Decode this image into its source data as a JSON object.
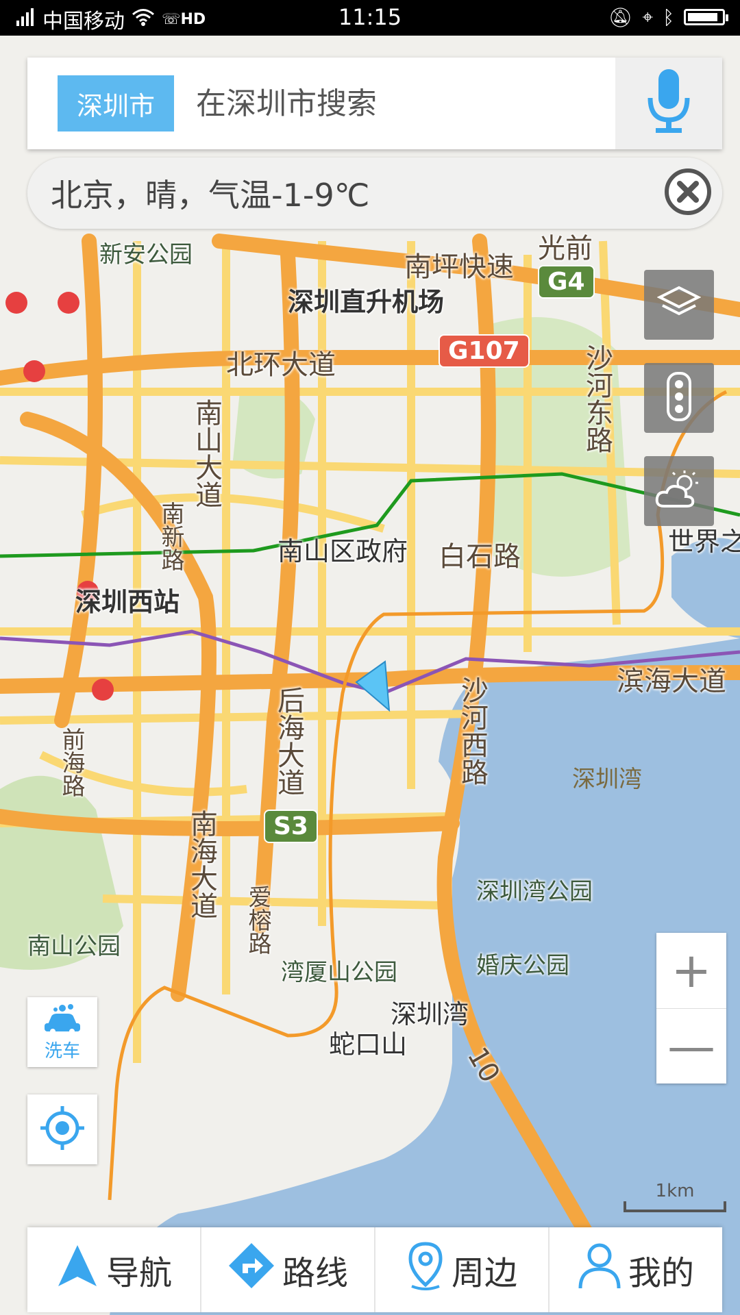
{
  "status_bar": {
    "carrier": "中国移动",
    "network": "HD",
    "time": "11:15",
    "battery_level": 0.9
  },
  "search": {
    "city_button": "深圳市",
    "placeholder": "在深圳市搜索"
  },
  "weather": {
    "text": "北京，晴，气温-1-9℃"
  },
  "map": {
    "labels": {
      "xinan_park": "新安公园",
      "nanping_expressway": "南坪快速",
      "guangqian": "光前",
      "heliport": "深圳直升机场",
      "beihuan_road": "北环大道",
      "shahe_east_road": "沙河东路",
      "nanshan_avenue": "南山大道",
      "nanxin_road": "南新路",
      "nanshan_gov": "南山区政府",
      "baishi_road": "白石路",
      "world_window": "世界之",
      "shenzhen_west_station": "深圳西站",
      "binhai_avenue": "滨海大道",
      "houhai_avenue": "后海大道",
      "shahe_west_road": "沙河西路",
      "qianhai_road": "前海路",
      "shenzhen_bay": "深圳湾",
      "nanhai_avenue": "南海大道",
      "aiyu_road": "爱榕路",
      "shenzhen_bay_park": "深圳湾公园",
      "nanshan_park": "南山公园",
      "wanxiashan_park": "湾厦山公园",
      "hunqing_park": "婚庆公园",
      "shenzhen_bay_2": "深圳湾",
      "shekou_mountain": "蛇口山",
      "route_10": "10"
    },
    "shields": {
      "g4": "G4",
      "g107": "G107",
      "s3": "S3"
    },
    "wash_marker": "洗",
    "colors": {
      "water": "#9dbfe0",
      "major_road": "#f4a640",
      "minor_road": "#fad873",
      "park": "#cfe3b8",
      "metro_green": "#1e9a1e",
      "metro_purple": "#8b55b5",
      "metro_orange": "#f39a2a"
    }
  },
  "controls": {
    "layers_icon": "layers-icon",
    "traffic_icon": "traffic-light-icon",
    "weather_icon": "weather-icon",
    "zoom_in": "+",
    "zoom_out": "—",
    "car_wash_label": "洗车",
    "locate_icon": "locate-icon"
  },
  "scale": {
    "label": "1km"
  },
  "bottom_nav": {
    "items": [
      {
        "label": "导航",
        "icon": "navigation-arrow-icon"
      },
      {
        "label": "路线",
        "icon": "route-icon"
      },
      {
        "label": "周边",
        "icon": "location-pin-icon"
      },
      {
        "label": "我的",
        "icon": "user-icon"
      }
    ]
  }
}
